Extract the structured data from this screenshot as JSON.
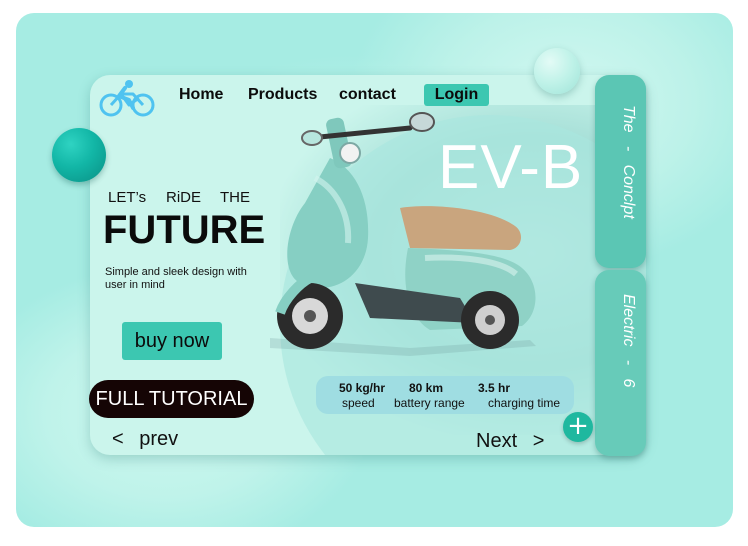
{
  "nav": {
    "home": "Home",
    "products": "Products",
    "contact": "contact",
    "login": "Login"
  },
  "hero": {
    "model": "EV-B",
    "lets_words": [
      "LET’s",
      "RiDE",
      "THE"
    ],
    "headline": "FUTURE",
    "description": "Simple and sleek design with user in mind",
    "buy_button": "buy now",
    "tutorial_button": "FULL TUTORIAL"
  },
  "specs": [
    {
      "value": "50 kg/hr",
      "label": "speed"
    },
    {
      "value": "80 km",
      "label": "battery range"
    },
    {
      "value": "3.5 hr",
      "label": "charging time"
    }
  ],
  "pager": {
    "prev_arrow": "<",
    "prev": "prev",
    "next": "Next",
    "next_arrow": ">"
  },
  "side_tabs": {
    "tab1": "The   -   Conclpt",
    "tab2": "Electric   -   6"
  },
  "colors": {
    "accent": "#3cc7b1",
    "background": "#a6ece3",
    "card": "#cbf5ec",
    "dark_button": "#150505"
  },
  "icons": [
    "cyclist-logo-icon",
    "plus-icon"
  ]
}
